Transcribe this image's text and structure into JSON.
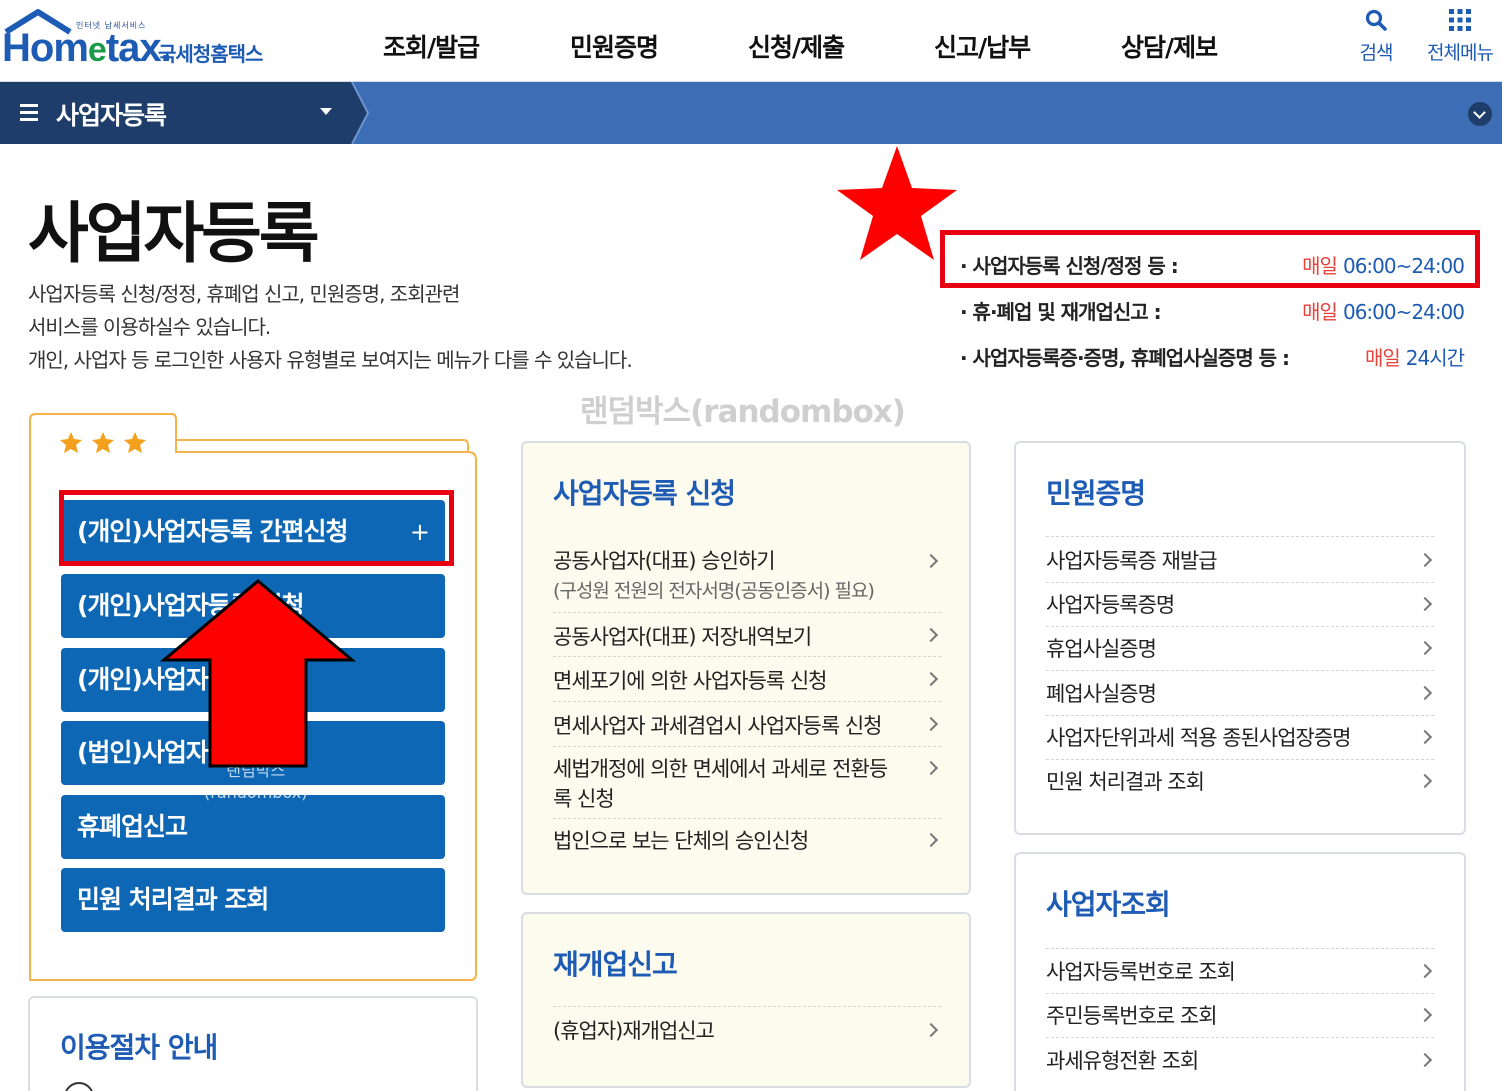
{
  "logo": {
    "subtitle": "인터넷 납세서비스",
    "brand": "Hom",
    "brand_e": "e",
    "brand_tail": "tax.",
    "korean": "국세청홈택스"
  },
  "gnb": [
    {
      "label": "조회/발급"
    },
    {
      "label": "민원증명"
    },
    {
      "label": "신청/제출"
    },
    {
      "label": "신고/납부"
    },
    {
      "label": "상담/제보"
    }
  ],
  "util": {
    "search_label": "검색",
    "all_menu_label": "전체메뉴"
  },
  "subbar": {
    "title": "사업자등록"
  },
  "page": {
    "title": "사업자등록",
    "desc_1": "사업자등록 신청/정정, 휴폐업 신고, 민원증명, 조회관련",
    "desc_2": "서비스를 이용하실수 있습니다.",
    "desc_3": "개인, 사업자 등 로그인한 사용자 유형별로 보여지는 메뉴가 다를 수 있습니다."
  },
  "hours": [
    {
      "label": "· 사업자등록 신청/정정 등 :",
      "daily": "매일",
      "time": "06:00~24:00"
    },
    {
      "label": "· 휴·폐업 및 재개업신고 :",
      "daily": "매일",
      "time": "06:00~24:00"
    },
    {
      "label": "· 사업자등록증·증명, 휴폐업사실증명 등 :",
      "daily": "매일",
      "time": "24시간"
    }
  ],
  "watermark": "랜덤박스(randombox)",
  "watermark_small_1": "랜덤박스",
  "watermark_small_2": "(randombox)",
  "favorites": {
    "buttons": [
      {
        "label": "(개인)사업자등록 간편신청",
        "plus": "+"
      },
      {
        "label": "(개인)사업자등록 신청"
      },
      {
        "label": "(개인)사업자등록 정정"
      },
      {
        "label": "(법인)사업자등록 신청"
      },
      {
        "label": "휴폐업신고"
      },
      {
        "label": "민원 처리결과 조회"
      }
    ]
  },
  "process": {
    "title": "이용절차 안내"
  },
  "cards": {
    "apply": {
      "title": "사업자등록 신청",
      "items": [
        {
          "label": "공동사업자(대표) 승인하기",
          "sub": "(구성원 전원의 전자서명(공동인증서) 필요)"
        },
        {
          "label": "공동사업자(대표) 저장내역보기"
        },
        {
          "label": "면세포기에 의한 사업자등록 신청"
        },
        {
          "label": "면세사업자 과세겸업시 사업자등록 신청"
        },
        {
          "label": "세법개정에 의한 면세에서 과세로 전환등",
          "sub": "록 신청"
        },
        {
          "label": "법인으로 보는 단체의 승인신청"
        }
      ]
    },
    "reopen": {
      "title": "재개업신고",
      "items": [
        {
          "label": "(휴업자)재개업신고"
        }
      ]
    },
    "civil": {
      "title": "민원증명",
      "items": [
        {
          "label": "사업자등록증 재발급"
        },
        {
          "label": "사업자등록증명"
        },
        {
          "label": "휴업사실증명"
        },
        {
          "label": "폐업사실증명"
        },
        {
          "label": "사업자단위과세 적용 종된사업장증명"
        },
        {
          "label": "민원 처리결과 조회"
        }
      ]
    },
    "lookup": {
      "title": "사업자조회",
      "items": [
        {
          "label": "사업자등록번호로 조회"
        },
        {
          "label": "주민등록번호로 조회"
        },
        {
          "label": "과세유형전환 조회"
        }
      ]
    }
  },
  "colors": {
    "brand_blue": "#1d5bb4",
    "button_blue": "#0d67b4",
    "subbar_blue": "#3d6eb5",
    "daily_red": "#e8413a",
    "annotation_red": "#e60012",
    "fav_border": "#f5b34a",
    "card_yellow": "#fdfbee"
  }
}
